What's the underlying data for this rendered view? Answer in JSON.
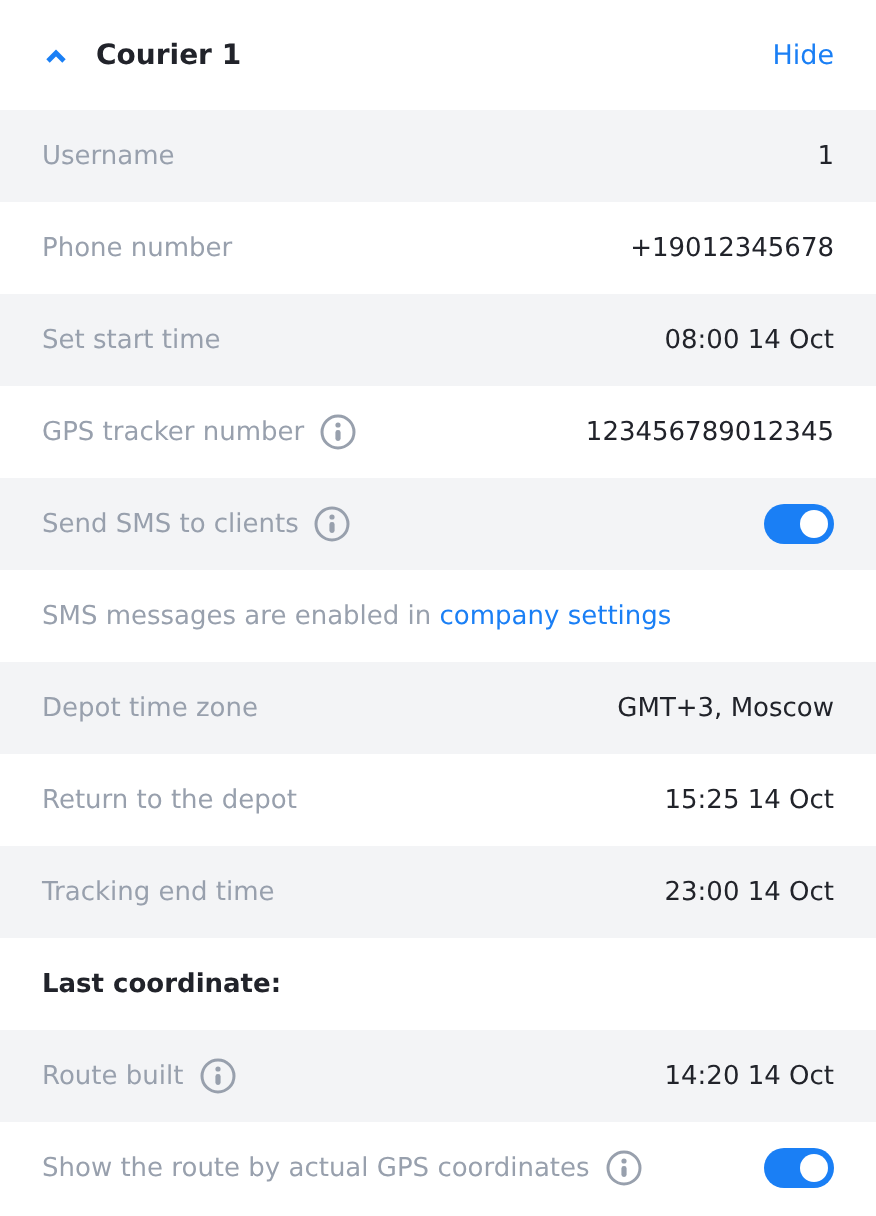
{
  "header": {
    "title": "Courier 1",
    "expanded": true,
    "action": "Hide"
  },
  "rows": [
    {
      "kind": "value",
      "label": "Username",
      "value": "1"
    },
    {
      "kind": "value",
      "label": "Phone number",
      "value": "+19012345678"
    },
    {
      "kind": "value",
      "label": "Set start time",
      "value": "08:00 14 Oct"
    },
    {
      "kind": "value",
      "label": "GPS tracker number",
      "info": true,
      "value": "123456789012345"
    },
    {
      "kind": "toggle",
      "label": "Send SMS to clients",
      "info": true,
      "on": true
    },
    {
      "kind": "note",
      "text": "SMS messages are enabled in ",
      "link": "company settings"
    },
    {
      "kind": "value",
      "label": "Depot time zone",
      "value": "GMT+3, Moscow"
    },
    {
      "kind": "value",
      "label": "Return to the depot",
      "value": "15:25 14 Oct"
    },
    {
      "kind": "value",
      "label": "Tracking end time",
      "value": "23:00 14 Oct"
    },
    {
      "kind": "section",
      "label": "Last coordinate:"
    },
    {
      "kind": "value",
      "label": "Route built",
      "info": true,
      "value": "14:20 14 Oct"
    },
    {
      "kind": "toggle",
      "label": "Show the route by actual GPS coordinates",
      "info": true,
      "on": true
    }
  ]
}
